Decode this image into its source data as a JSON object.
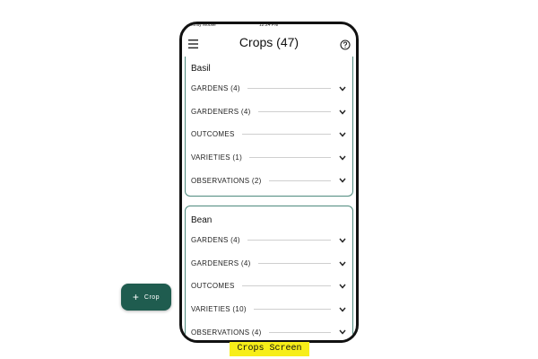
{
  "status_bar": {
    "carrier": "Xfinity Mobile",
    "time": "12:24 PM"
  },
  "app_bar": {
    "title": "Crops (47)"
  },
  "crops": [
    {
      "name": "Basil",
      "sections": [
        {
          "label": "GARDENS  (4)"
        },
        {
          "label": "GARDENERS  (4)"
        },
        {
          "label": "OUTCOMES"
        },
        {
          "label": "VARIETIES  (1)"
        },
        {
          "label": "OBSERVATIONS  (2)"
        }
      ]
    },
    {
      "name": "Bean",
      "sections": [
        {
          "label": "GARDENS  (4)"
        },
        {
          "label": "GARDENERS  (4)"
        },
        {
          "label": "OUTCOMES"
        },
        {
          "label": "VARIETIES  (10)"
        },
        {
          "label": "OBSERVATIONS  (4)"
        }
      ]
    }
  ],
  "fab": {
    "label": "Crop",
    "icon": "plus-icon"
  },
  "caption": "Crops Screen",
  "colors": {
    "accent": "#1f5c4f",
    "card_border": "#4f8a7e",
    "caption_bg": "#f7ee19"
  }
}
